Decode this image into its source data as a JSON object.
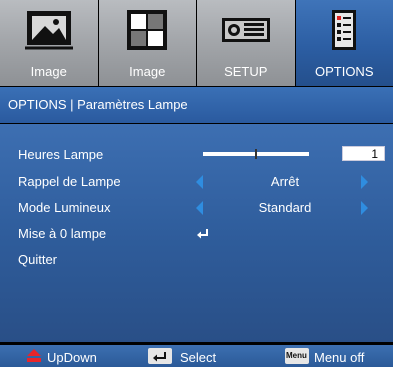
{
  "tabs": [
    {
      "label": "Image",
      "icon": "picture-frame-icon",
      "active": false
    },
    {
      "label": "Image",
      "icon": "grayscale-grid-icon",
      "active": false
    },
    {
      "label": "SETUP",
      "icon": "projector-icon",
      "active": false
    },
    {
      "label": "OPTIONS",
      "icon": "checklist-icon",
      "active": true
    }
  ],
  "title": "OPTIONS | Paramètres Lampe",
  "menu": {
    "lamp_hours": {
      "label": "Heures Lampe",
      "value": "1",
      "slider_level": 0.5
    },
    "lamp_reminder": {
      "label": "Rappel de Lampe",
      "value": "Arrêt"
    },
    "brightness_mode": {
      "label": "Mode Lumineux",
      "value": "Standard"
    },
    "lamp_reset": {
      "label": "Mise à 0 lampe"
    },
    "exit": {
      "label": "Quitter"
    }
  },
  "footer": {
    "updown": "UpDown",
    "select": "Select",
    "menu_key": "Menu",
    "menu_off": "Menu off"
  },
  "colors": {
    "accent": "#2f5d9c",
    "arrow": "#2f8de0",
    "updown_icon": "#e8252a"
  }
}
